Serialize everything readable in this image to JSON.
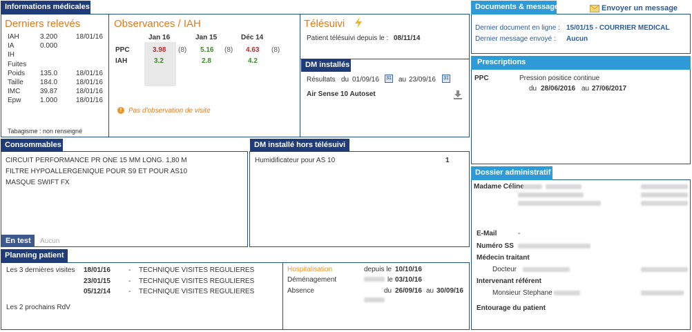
{
  "medical": {
    "header": "Informations médicales",
    "derniers": {
      "title": "Derniers relevés",
      "rows": [
        {
          "label": "IAH",
          "value": "3.200",
          "date": "18/01/16"
        },
        {
          "label": "IA",
          "value": "0.000",
          "date": ""
        },
        {
          "label": "IH",
          "value": "",
          "date": ""
        },
        {
          "label": "Fuites",
          "value": "",
          "date": ""
        },
        {
          "label": "Poids",
          "value": "135.0",
          "date": "18/01/16"
        },
        {
          "label": "Taille",
          "value": "184.0",
          "date": "18/01/16"
        },
        {
          "label": "IMC",
          "value": "39.87",
          "date": "18/01/16"
        },
        {
          "label": "Epw",
          "value": "1.000",
          "date": "18/01/16"
        }
      ],
      "tabagisme": "Tabagisme : non renseigné"
    },
    "observances": {
      "title": "Observances / IAH",
      "columns": [
        "Jan 16",
        "Jan 15",
        "Déc 14"
      ],
      "ppc_label": "PPC",
      "iah_label": "IAH",
      "ppc": [
        {
          "value": "3.98",
          "count": "(8)"
        },
        {
          "value": "5.16",
          "count": "(8)"
        },
        {
          "value": "4.63",
          "count": "(8)"
        }
      ],
      "iah": [
        "3.2",
        "2.8",
        "4.2"
      ],
      "note": "Pas d'observation de visite"
    },
    "telesuivi": {
      "title": "Télésuivi",
      "since_label": "Patient télésuivi depuis le :",
      "since_date": "08/11/14"
    },
    "dm_installes": {
      "header": "DM installés",
      "results_label": "Résultats",
      "du_label": "du",
      "from": "01/09/16",
      "au_label": "au",
      "to": "23/09/16",
      "device": "Air Sense 10 Autoset"
    }
  },
  "consommables": {
    "header": "Consommables",
    "items": [
      "CIRCUIT PERFORMANCE PR ONE 15 MM LONG. 1,80 M",
      "FILTRE HYPOALLERGENIQUE POUR S9 ET POUR AS10",
      "MASQUE SWIFT FX"
    ],
    "en_test_label": "En test",
    "en_test_value": "Aucun"
  },
  "dm_hors": {
    "header": "DM installé hors télésuivi",
    "items": [
      {
        "name": "Humidificateur pour AS 10",
        "qty": "1"
      }
    ]
  },
  "planning": {
    "header": "Planning patient",
    "last_visits_label": "Les 3 dernières visites",
    "visits": [
      {
        "date": "18/01/16",
        "dash": "-",
        "desc": "TECHNIQUE VISITES REGULIERES"
      },
      {
        "date": "23/01/15",
        "dash": "-",
        "desc": "TECHNIQUE VISITES REGULIERES"
      },
      {
        "date": "05/12/14",
        "dash": "-",
        "desc": "TECHNIQUE VISITES REGULIERES"
      }
    ],
    "next_label": "Les 2 prochains RdV",
    "events": [
      {
        "label": "Hospitalisation",
        "mid": "depuis le",
        "date": "10/10/16",
        "au": "",
        "date2": ""
      },
      {
        "label": "Déménagement",
        "mid": "le",
        "date": "03/10/16",
        "au": "",
        "date2": ""
      },
      {
        "label": "Absence",
        "mid": "du",
        "date": "26/09/16",
        "au": "au",
        "date2": "30/09/16"
      }
    ]
  },
  "documents": {
    "header": "Documents & messages",
    "send_label": "Envoyer un message",
    "last_doc_label": "Dernier document en ligne :",
    "last_doc_value": "15/01/15 - COURRIER MEDICAL",
    "last_msg_label": "Dernier message envoyé :",
    "last_msg_value": "Aucun"
  },
  "prescriptions": {
    "header": "Prescriptions",
    "type": "PPC",
    "desc": "Pression positice continue",
    "du_label": "du",
    "from": "28/06/2016",
    "au_label": "au",
    "to": "27/06/2017"
  },
  "admin": {
    "header": "Dossier administratif",
    "name": "Madame Céline",
    "email_label": "E-Mail",
    "email_value": "-",
    "ss_label": "Numéro SS",
    "medecin_label": "Médecin traitant",
    "medecin_name": "Docteur",
    "intervenant_label": "Intervenant référent",
    "intervenant_name": "Monsieur Stephane",
    "entourage_label": "Entourage du patient"
  },
  "colors": {
    "navy": "#1f3c78",
    "accent_blue": "#2e9bd6",
    "orange": "#e07a1a",
    "red": "#c0282a",
    "green": "#3a8a2a"
  }
}
